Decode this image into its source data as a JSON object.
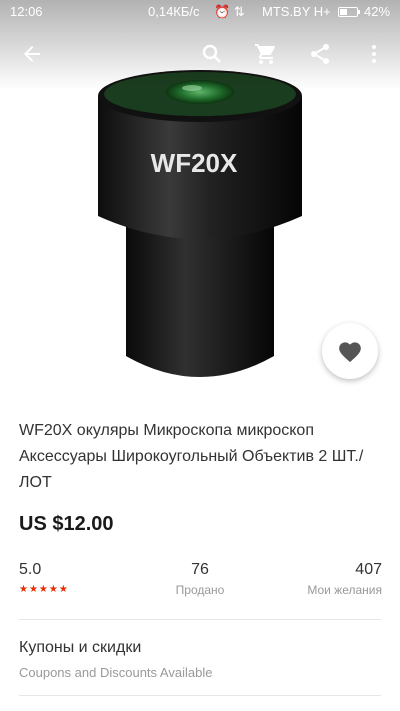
{
  "status_bar": {
    "time": "12:06",
    "network_speed": "0,14КБ/с",
    "carrier": "MTS.BY H+",
    "battery": "42%"
  },
  "toolbar": {
    "back_icon": "arrow-left",
    "search_icon": "search",
    "cart_icon": "shopping-cart",
    "share_icon": "share",
    "more_icon": "more-vertical"
  },
  "product": {
    "image_label": "WF20X",
    "title": "WF20X окуляры Микроскопа микроскоп Аксессуары Широкоугольный Объектив 2 ШТ./ЛОТ",
    "price": "US $12.00",
    "rating": "5.0",
    "stars": "★★★★★",
    "sold_count": "76",
    "sold_label": "Продано",
    "wishlist_count": "407",
    "wishlist_label": "Мои желания"
  },
  "coupons": {
    "title": "Купоны и скидки",
    "subtitle": "Coupons and Discounts Available"
  },
  "colors": {
    "accent_red": "#e62e04",
    "lens_green": "#1f6b2a"
  }
}
